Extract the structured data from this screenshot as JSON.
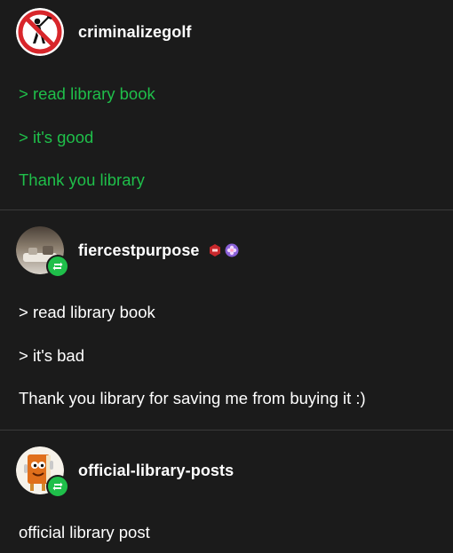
{
  "posts": [
    {
      "username": "criminalizegolf",
      "avatar_icon": "no-golf-icon",
      "lines": [
        "> read library book",
        "> it's good",
        "Thank you library"
      ],
      "text_color": "#1fbf4a"
    },
    {
      "username": "fiercestpurpose",
      "avatar_icon": "photo-avatar",
      "reblog_icon": "reblog-icon",
      "badges": [
        "hexagon-badge-icon",
        "purple-flower-badge-icon"
      ],
      "lines": [
        "> read library book",
        "> it's bad",
        "Thank you library for saving me from buying it :)"
      ],
      "text_color": "#ffffff"
    },
    {
      "username": "official-library-posts",
      "avatar_icon": "book-character-icon",
      "reblog_icon": "reblog-icon",
      "lines": [
        "official library post"
      ],
      "text_color": "#ffffff"
    }
  ],
  "colors": {
    "background": "#1b1b1b",
    "accent_green": "#1fbf4a",
    "divider": "#3a3a3a"
  }
}
